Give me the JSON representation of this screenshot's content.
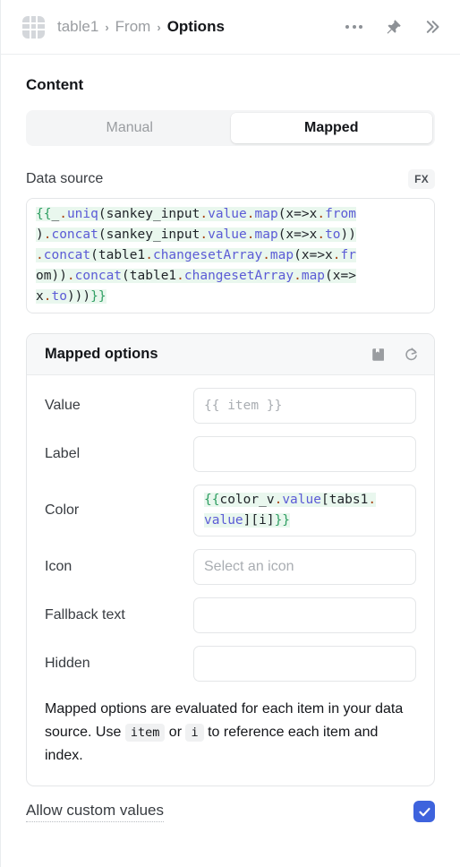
{
  "header": {
    "app_icon": "table-grid-icon",
    "breadcrumb": [
      {
        "label": "table1",
        "active": false
      },
      {
        "label": "From",
        "active": false
      },
      {
        "label": "Options",
        "active": true
      }
    ],
    "separator": "›",
    "actions": [
      {
        "name": "more-options",
        "icon": "ellipsis-icon"
      },
      {
        "name": "pin",
        "icon": "pin-icon"
      },
      {
        "name": "expand",
        "icon": "chevrons-right-icon"
      }
    ]
  },
  "content": {
    "section_title": "Content",
    "tabs": [
      {
        "label": "Manual",
        "active": false
      },
      {
        "label": "Mapped",
        "active": true
      }
    ]
  },
  "data_source": {
    "label": "Data source",
    "fx_label": "FX",
    "code_lines": [
      [
        {
          "t": "{{",
          "c": "brace"
        },
        {
          "t": "_",
          "c": "plain"
        },
        {
          "t": ".",
          "c": "dot"
        },
        {
          "t": "uniq",
          "c": "prop"
        },
        {
          "t": "(sankey_input",
          "c": "plain"
        },
        {
          "t": ".",
          "c": "dot"
        },
        {
          "t": "value",
          "c": "prop"
        },
        {
          "t": ".",
          "c": "dot"
        },
        {
          "t": "map",
          "c": "prop"
        },
        {
          "t": "(x=>x",
          "c": "plain"
        },
        {
          "t": ".",
          "c": "dot"
        },
        {
          "t": "from",
          "c": "prop"
        }
      ],
      [
        {
          "t": ")",
          "c": "plain"
        },
        {
          "t": ".",
          "c": "dot"
        },
        {
          "t": "concat",
          "c": "prop"
        },
        {
          "t": "(sankey_input",
          "c": "plain"
        },
        {
          "t": ".",
          "c": "dot"
        },
        {
          "t": "value",
          "c": "prop"
        },
        {
          "t": ".",
          "c": "dot"
        },
        {
          "t": "map",
          "c": "prop"
        },
        {
          "t": "(x=>x",
          "c": "plain"
        },
        {
          "t": ".",
          "c": "dot"
        },
        {
          "t": "to",
          "c": "prop"
        },
        {
          "t": "))",
          "c": "plain"
        }
      ],
      [
        {
          "t": ".",
          "c": "dot"
        },
        {
          "t": "concat",
          "c": "prop"
        },
        {
          "t": "(table1",
          "c": "plain"
        },
        {
          "t": ".",
          "c": "dot"
        },
        {
          "t": "changesetArray",
          "c": "prop"
        },
        {
          "t": ".",
          "c": "dot"
        },
        {
          "t": "map",
          "c": "prop"
        },
        {
          "t": "(x=>x",
          "c": "plain"
        },
        {
          "t": ".",
          "c": "dot"
        },
        {
          "t": "fr",
          "c": "prop"
        }
      ],
      [
        {
          "t": "om))",
          "c": "plain"
        },
        {
          "t": ".",
          "c": "dot"
        },
        {
          "t": "concat",
          "c": "prop"
        },
        {
          "t": "(table1",
          "c": "plain"
        },
        {
          "t": ".",
          "c": "dot"
        },
        {
          "t": "changesetArray",
          "c": "prop"
        },
        {
          "t": ".",
          "c": "dot"
        },
        {
          "t": "map",
          "c": "prop"
        },
        {
          "t": "(x=>",
          "c": "plain"
        }
      ],
      [
        {
          "t": "x",
          "c": "plain"
        },
        {
          "t": ".",
          "c": "dot"
        },
        {
          "t": "to",
          "c": "prop"
        },
        {
          "t": ")))",
          "c": "plain"
        },
        {
          "t": "}}",
          "c": "brace"
        }
      ]
    ],
    "code_text": "{{_.uniq(sankey_input.value.map(x=>x.from).concat(sankey_input.value.map(x=>x.to)).concat(table1.changesetArray.map(x=>x.from)).concat(table1.changesetArray.map(x=>x.to)))}}"
  },
  "mapped_options": {
    "title": "Mapped options",
    "header_icons": [
      {
        "name": "docs-book",
        "icon": "book-icon"
      },
      {
        "name": "reset",
        "icon": "reset-arrow-icon"
      }
    ],
    "fields": [
      {
        "label": "Value",
        "value": "",
        "placeholder": "{{ item }}",
        "kind": "mono"
      },
      {
        "label": "Label",
        "value": "",
        "placeholder": "",
        "kind": "mono"
      },
      {
        "label": "Color",
        "value": "{{color_v.value[tabs1.value][i]}}",
        "placeholder": "",
        "kind": "code"
      },
      {
        "label": "Icon",
        "value": "",
        "placeholder": "Select an icon",
        "kind": "sans"
      },
      {
        "label": "Fallback text",
        "value": "",
        "placeholder": "",
        "kind": "mono"
      },
      {
        "label": "Hidden",
        "value": "",
        "placeholder": "",
        "kind": "mono"
      }
    ],
    "color_code_lines": [
      [
        {
          "t": "{{",
          "c": "brace"
        },
        {
          "t": "color_v",
          "c": "plain"
        },
        {
          "t": ".",
          "c": "dot"
        },
        {
          "t": "value",
          "c": "prop"
        },
        {
          "t": "[tabs1",
          "c": "plain"
        },
        {
          "t": ".",
          "c": "dot"
        }
      ],
      [
        {
          "t": "value",
          "c": "prop"
        },
        {
          "t": "][i]",
          "c": "plain"
        },
        {
          "t": "}}",
          "c": "brace"
        }
      ]
    ],
    "help": {
      "part1": "Mapped options are evaluated for each item in your data source. Use",
      "chip1": "item",
      "part2": "or",
      "chip2": "i",
      "part3": "to reference each item and index."
    }
  },
  "footer": {
    "allow_custom_values_label": "Allow custom values",
    "allow_custom_values_checked": true,
    "accent_color": "#3e63dd"
  }
}
